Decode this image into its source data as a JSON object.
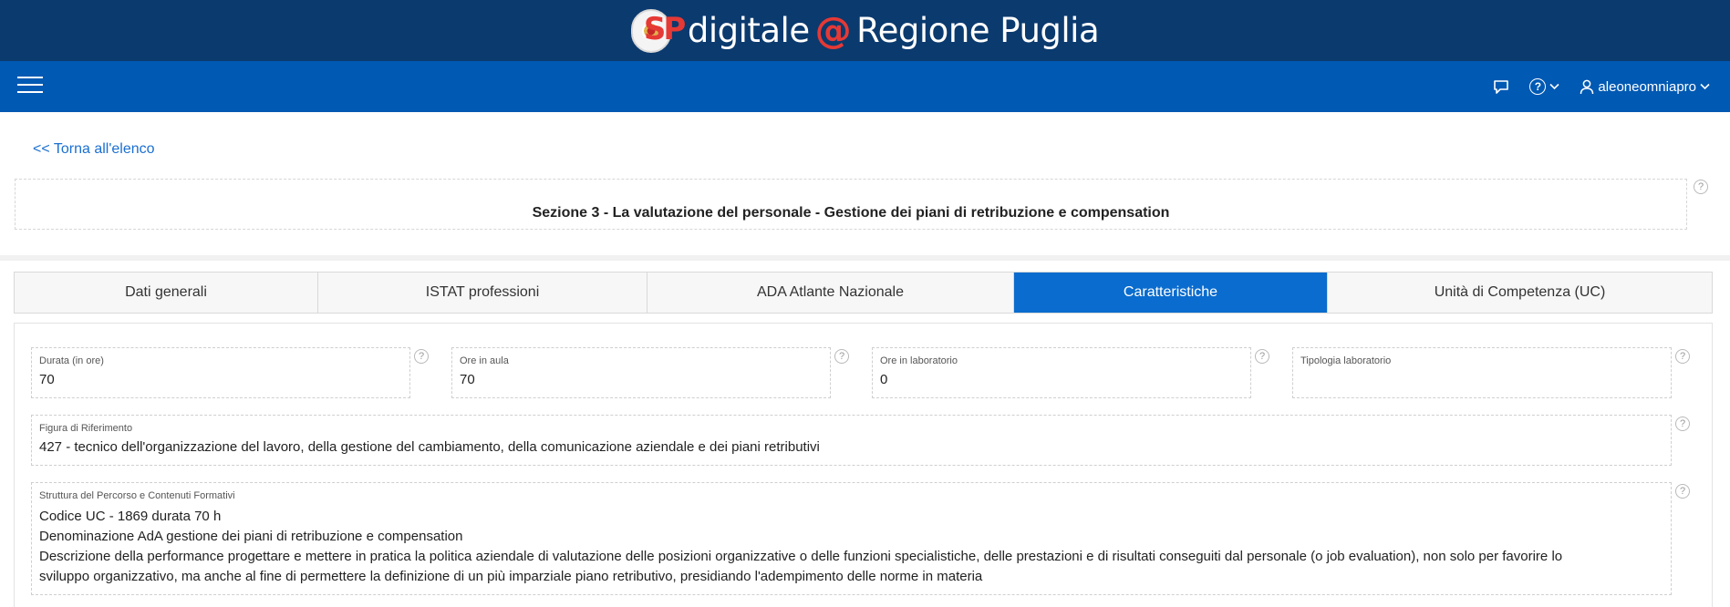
{
  "brand": {
    "logo_text": "SP",
    "text_left": "digitale",
    "text_at": "@",
    "text_right": "Regione Puglia"
  },
  "navbar": {
    "menu_icon": "hamburger-icon",
    "chat_icon": "chat-bubble-icon",
    "help_icon": "question-circle-icon",
    "help_symbol": "?",
    "user_icon": "user-icon",
    "username": "aleoneomniapro",
    "chevron": "⌄"
  },
  "back_link": "<< Torna all'elenco",
  "section_title": "Sezione 3 - La valutazione del personale - Gestione dei piani di retribuzione e compensation",
  "help_symbol": "?",
  "tabs": [
    {
      "label": "Dati generali",
      "active": false
    },
    {
      "label": "ISTAT professioni",
      "active": false
    },
    {
      "label": "ADA Atlante Nazionale",
      "active": false
    },
    {
      "label": "Caratteristiche",
      "active": true
    },
    {
      "label": "Unità di Competenza (UC)",
      "active": false
    }
  ],
  "fields": {
    "durata": {
      "label": "Durata (in ore)",
      "value": "70"
    },
    "ore_aula": {
      "label": "Ore in aula",
      "value": "70"
    },
    "ore_lab": {
      "label": "Ore in laboratorio",
      "value": "0"
    },
    "tipologia_lab": {
      "label": "Tipologia laboratorio",
      "value": ""
    },
    "figura": {
      "label": "Figura di Riferimento",
      "value": "427 - tecnico dell'organizzazione del lavoro, della gestione del cambiamento, della comunicazione aziendale e dei piani retributivi"
    },
    "struttura": {
      "label": "Struttura del Percorso e Contenuti Formativi",
      "lines": [
        "Codice UC - 1869 durata 70 h",
        "Denominazione AdA gestione dei piani di retribuzione e compensation",
        "Descrizione della performance progettare e mettere in pratica la politica aziendale di valutazione delle posizioni organizzative o delle funzioni specialistiche, delle prestazioni e di risultati conseguiti dal personale (o job evaluation), non solo per favorire lo",
        "sviluppo organizzativo, ma anche al fine di permettere la definizione di un più imparziale piano retributivo, presidiando l'adempimento delle norme in materia"
      ]
    }
  },
  "colors": {
    "brand_bar": "#0b3a6e",
    "nav_bar": "#0059b3",
    "tab_active": "#0a6cce",
    "link": "#1a6fd1",
    "at_sign": "#e53935"
  }
}
